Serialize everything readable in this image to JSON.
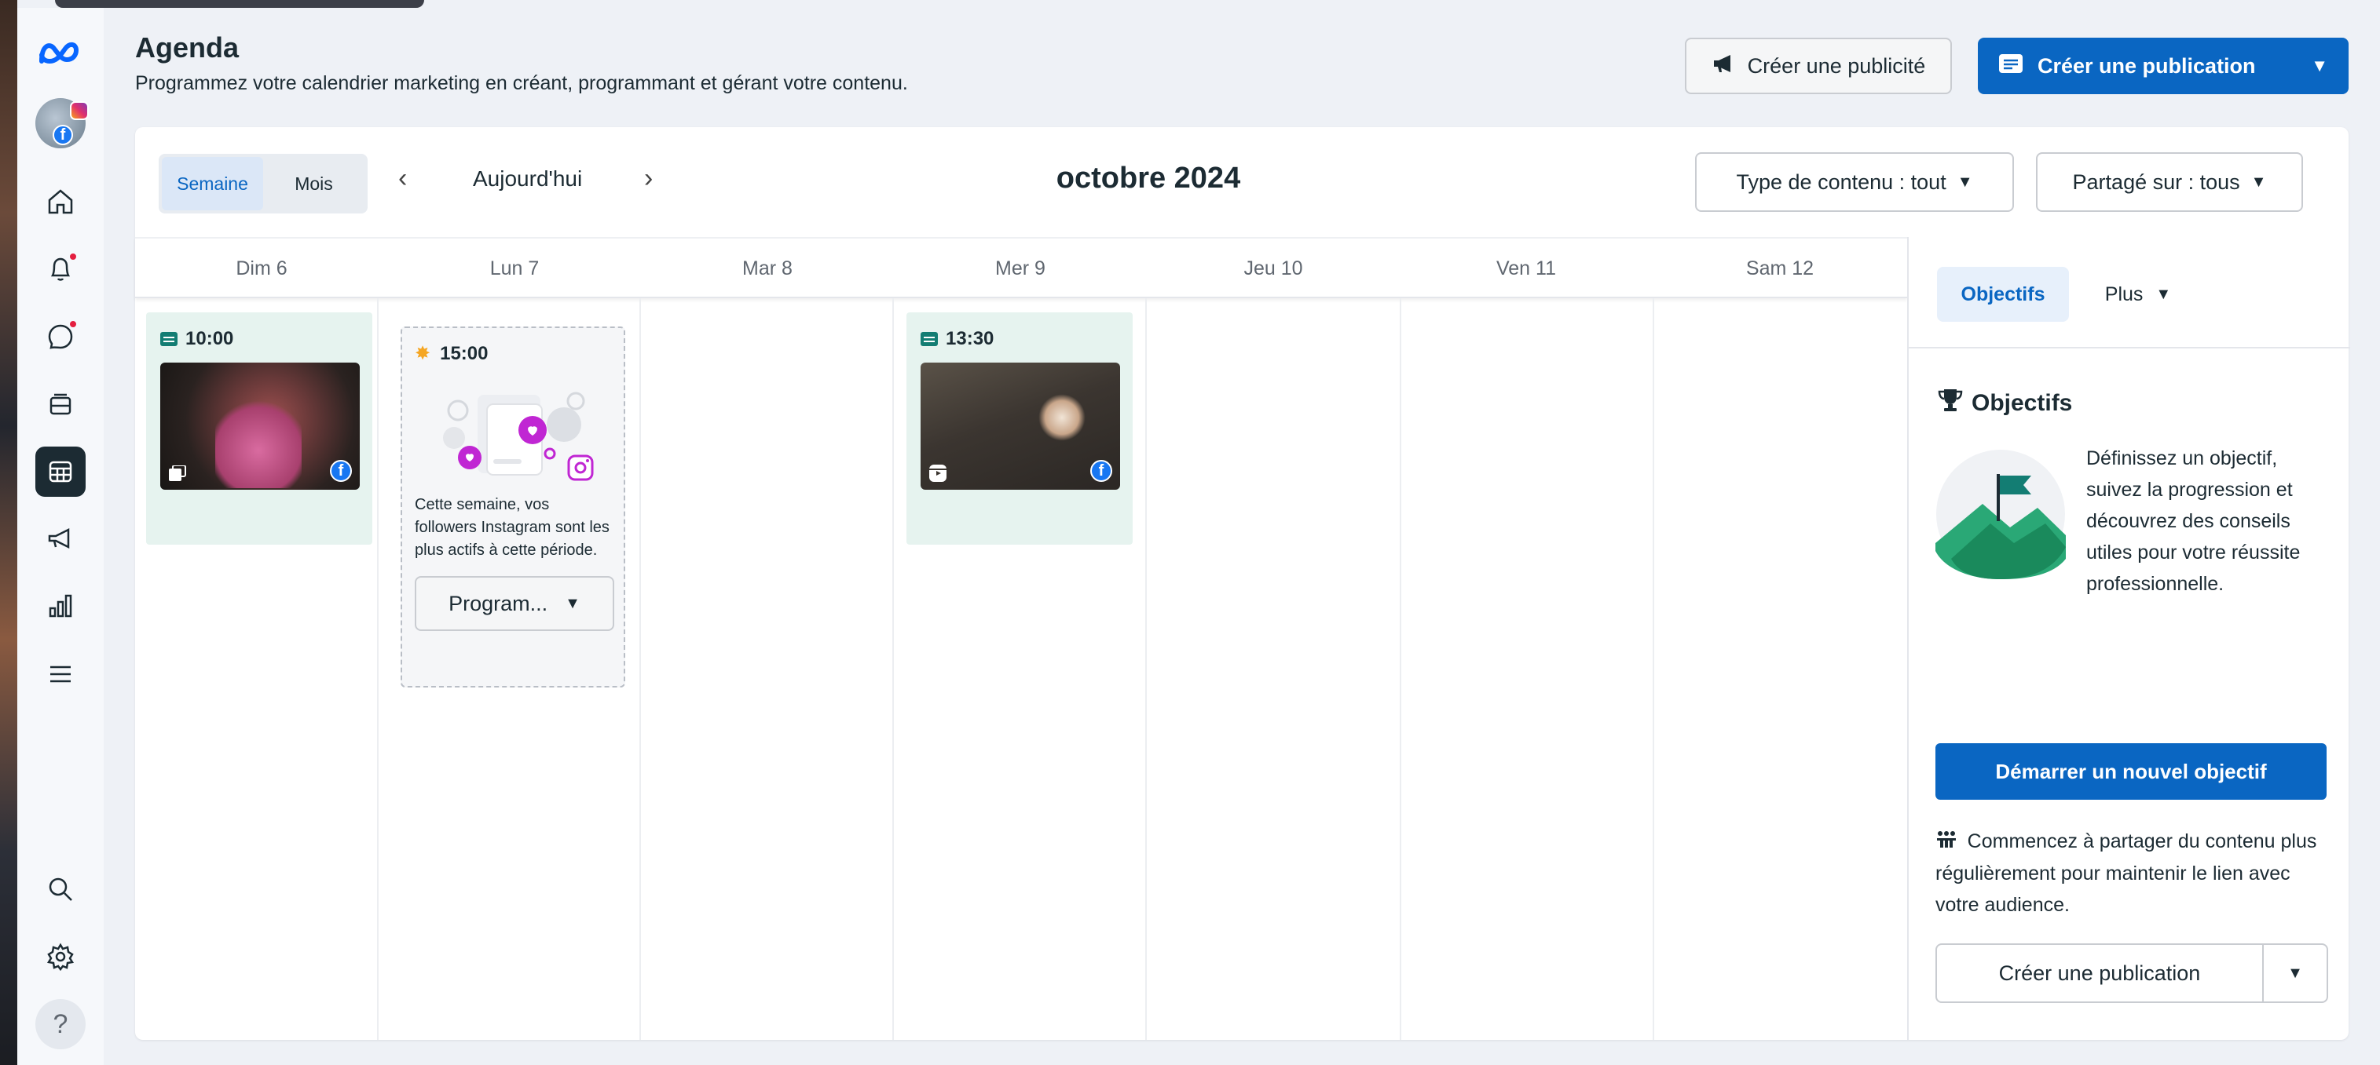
{
  "header": {
    "title": "Agenda",
    "subtitle": "Programmez votre calendrier marketing en créant, programmant et gérant votre contenu.",
    "create_ad_label": "Créer une publicité",
    "create_post_label": "Créer une publication"
  },
  "toolbar": {
    "view_week": "Semaine",
    "view_month": "Mois",
    "selected_view": "Semaine",
    "today_label": "Aujourd'hui",
    "month_title": "octobre 2024",
    "content_type_filter": "Type de contenu : tout",
    "shared_on_filter": "Partagé sur : tous"
  },
  "calendar": {
    "days": [
      "Dim 6",
      "Lun 7",
      "Mar 8",
      "Mer 9",
      "Jeu 10",
      "Ven 11",
      "Sam 12"
    ],
    "posts": [
      {
        "day": "Dim 6",
        "time": "10:00",
        "type_icon": "carousel-icon",
        "platform": "facebook"
      },
      {
        "day": "Mer 9",
        "time": "13:30",
        "type_icon": "reel-icon",
        "platform": "facebook"
      }
    ],
    "suggestion": {
      "day": "Lun 7",
      "time": "15:00",
      "text": "Cette semaine, vos followers Instagram sont les plus actifs à cette période.",
      "button_label": "Program..."
    }
  },
  "right_panel": {
    "tab_objectives": "Objectifs",
    "tab_more": "Plus",
    "objectives_title": "Objectifs",
    "objectives_desc": "Définissez un objectif, suivez la progression et découvrez des conseils utiles pour votre réussite professionnelle.",
    "start_goal_button": "Démarrer un nouvel objectif",
    "tip_text": "Commencez à partager du contenu plus régulièrement pour maintenir le lien avec votre audience.",
    "create_post_button": "Créer une publication"
  },
  "nav": {
    "items": [
      "home-icon",
      "notifications-icon",
      "inbox-icon",
      "content-icon",
      "planner-icon",
      "ads-icon",
      "insights-icon",
      "all-tools-icon",
      "search-icon",
      "settings-icon",
      "help-icon"
    ],
    "active": "planner-icon"
  },
  "colors": {
    "primary_blue": "#0a66c2",
    "post_card_bg": "#e6f3ef",
    "notification_dot": "#e41e3f",
    "dark_text": "#1c2b33"
  }
}
